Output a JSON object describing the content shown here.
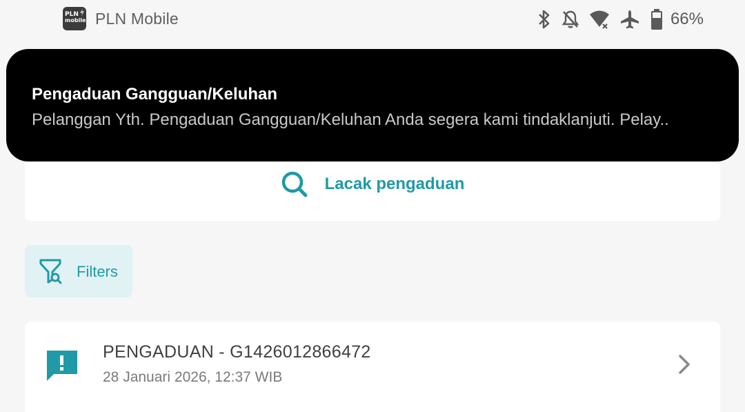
{
  "status_bar": {
    "app_icon_line1": "PLN",
    "app_icon_line2": "mobile",
    "app_name": "PLN Mobile",
    "battery_percent": "66%"
  },
  "notification": {
    "title": "Pengaduan Gangguan/Keluhan",
    "body": "Pelanggan Yth. Pengaduan Gangguan/Keluhan Anda segera kami tindaklanjuti. Pelay.."
  },
  "track": {
    "label": "Lacak pengaduan"
  },
  "filters": {
    "label": "Filters"
  },
  "complaints": [
    {
      "title": "PENGADUAN - G1426012866472",
      "date": "28 Januari 2026, 12:37 WIB"
    }
  ],
  "colors": {
    "accent": "#1f9aa6",
    "accent_light": "#e1f2f4",
    "background": "#f6f6f6",
    "notification_bg": "#000000"
  }
}
